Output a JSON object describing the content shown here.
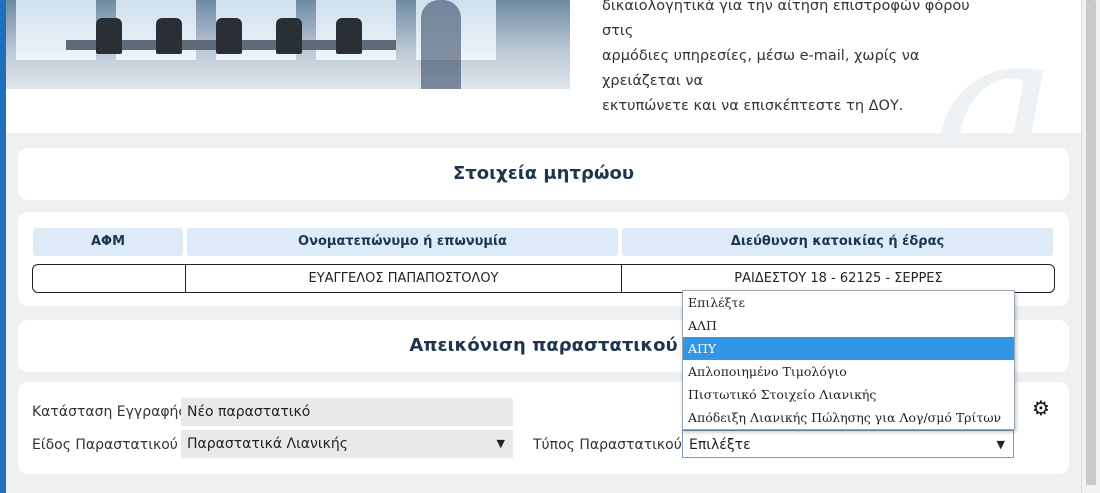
{
  "banner": {
    "text_lines": [
      "δικαιολογητικά για την αίτηση επιστροφών φόρου στις",
      "αρμόδιες υπηρεσίες, μέσω e-mail, χωρίς να χρειάζεται να",
      "εκτυπώνετε και να επισκέπτεστε τη ΔΟΥ."
    ]
  },
  "registry": {
    "title": "Στοιχεία μητρώου",
    "columns": [
      "ΑΦΜ",
      "Ονοματεπώνυμο ή επωνυμία",
      "Διεύθυνση κατοικίας ή έδρας"
    ],
    "row": {
      "afm": "",
      "name": "ΕΥΑΓΓΕΛΟΣ ΠΑΠΑΠΟΣΤΟΛΟΥ",
      "address": "ΡΑΙΔΕΣΤΟΥ 18 - 62125 - ΣΕΡΡΕΣ"
    }
  },
  "view": {
    "title": "Απεικόνιση παραστατικού"
  },
  "form": {
    "status_label": "Κατάσταση Εγγραφής",
    "status_value": "Νέο παραστατικό",
    "doc_kind_label": "Είδος Παραστατικού",
    "doc_kind_value": "Παραστατικά Λιανικής",
    "doc_type_label": "Τύπος Παραστατικού",
    "doc_type_value": "Επιλέξτε",
    "required_mark": "*"
  },
  "dropdown": {
    "options": [
      "Επιλέξτε",
      "ΑΛΠ",
      "ΑΠΥ",
      "Απλοποιημένο Τιμολόγιο",
      "Πιστωτικό Στοιχείο Λιανικής",
      "Απόδειξη Λιανικής Πώλησης για Λογ/σμό Τρίτων"
    ],
    "highlighted": "ΑΠΥ"
  },
  "icons": {
    "settings": "gear-icon",
    "select_caret": "caret-down-icon"
  },
  "colors": {
    "accent": "#3295e6",
    "header_bg": "#dcebf7",
    "frame": "#1f6fbf"
  }
}
